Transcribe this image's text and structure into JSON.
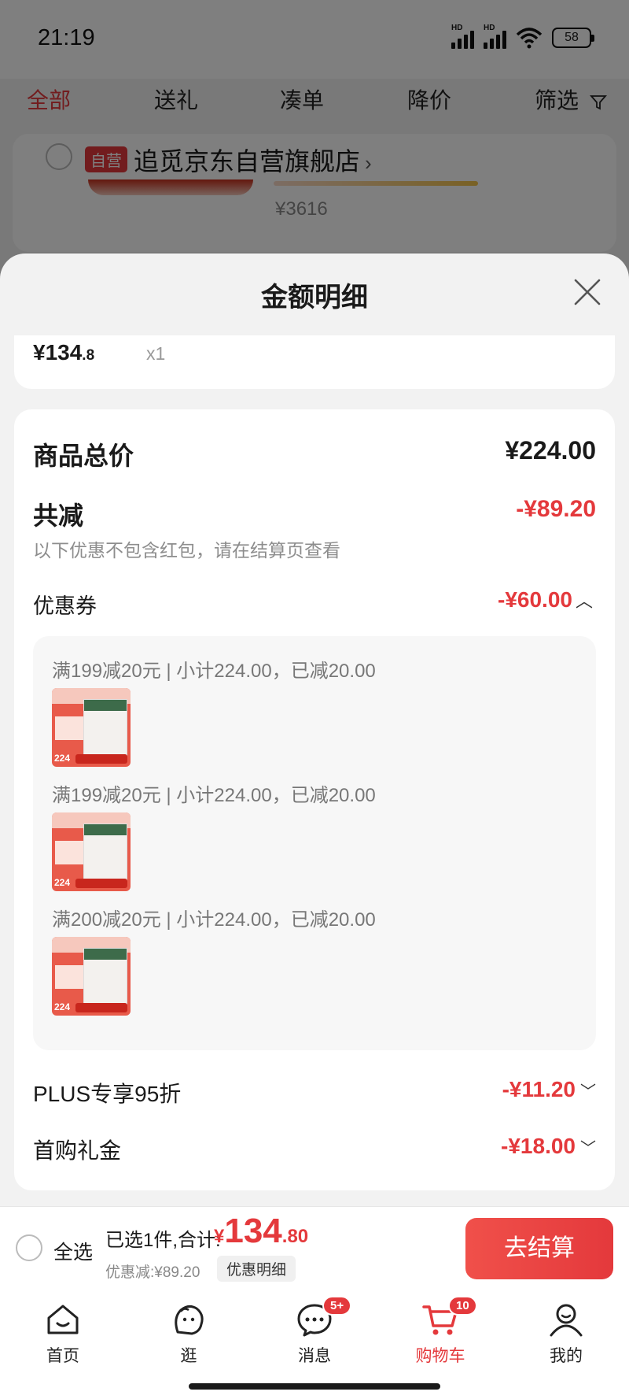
{
  "status_bar": {
    "time": "21:19",
    "battery": "58",
    "hd1": "HD",
    "hd2": "HD"
  },
  "filter_tabs": [
    "全部",
    "送礼",
    "凑单",
    "降价",
    "筛选"
  ],
  "background": {
    "badge": "自营",
    "store_name": "追觅京东自营旗舰店",
    "price": "¥3616"
  },
  "sheet": {
    "title": "金额明细",
    "item": {
      "price_int": "¥134",
      "price_dec": ".8",
      "qty": "x1"
    },
    "total_label": "商品总价",
    "total_value": "¥224.00",
    "reduce_label": "共减",
    "reduce_value": "-¥89.20",
    "reduce_note": "以下优惠不包含红包，请在结算页查看",
    "coupon_label": "优惠券",
    "coupon_value": "-¥60.00",
    "coupon_lines": [
      "满199减20元 | 小计224.00，已减20.00",
      "满199减20元 | 小计224.00，已减20.00",
      "满200减20元 | 小计224.00，已减20.00"
    ],
    "thumb_number": "224",
    "plus_label": "PLUS专享95折",
    "plus_value": "-¥11.20",
    "first_label": "首购礼金",
    "first_value": "-¥18.00"
  },
  "checkout": {
    "select_all": "全选",
    "summary": "已选1件,合计:",
    "currency": "¥",
    "total_int": "134",
    "total_dec": ".80",
    "discount": "优惠减:¥89.20",
    "detail_button": "优惠明细",
    "pay_button": "去结算"
  },
  "tabbar": [
    {
      "label": "首页",
      "icon": "home-icon"
    },
    {
      "label": "逛",
      "icon": "explore-icon"
    },
    {
      "label": "消息",
      "icon": "message-icon",
      "badge": "5+"
    },
    {
      "label": "购物车",
      "icon": "cart-icon",
      "badge": "10"
    },
    {
      "label": "我的",
      "icon": "profile-icon"
    }
  ],
  "colors": {
    "accent": "#e4393c"
  }
}
